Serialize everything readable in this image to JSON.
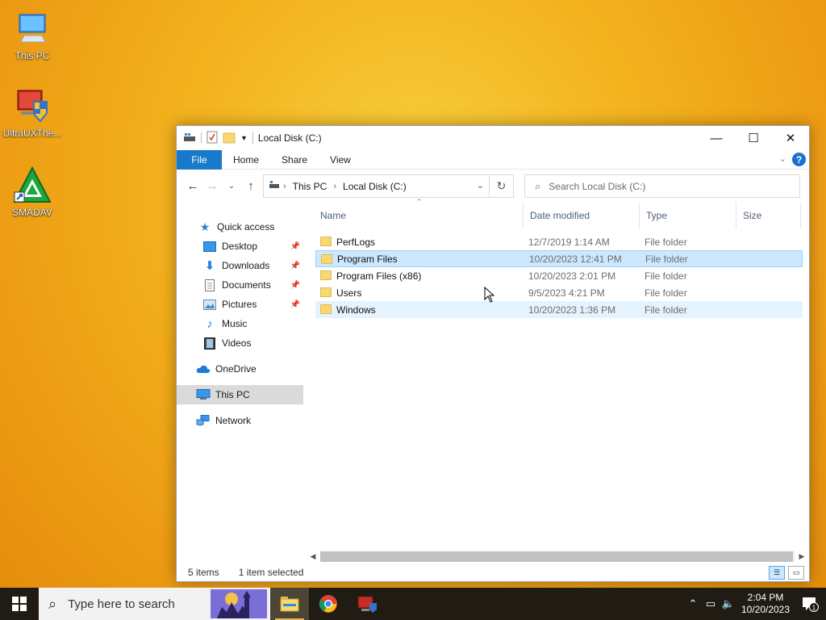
{
  "desktop": {
    "icons": [
      {
        "label": "This PC"
      },
      {
        "label": "UltraUXThe..."
      },
      {
        "label": "SMADAV"
      }
    ]
  },
  "window": {
    "title": "Local Disk (C:)",
    "ribbon_tabs": [
      "File",
      "Home",
      "Share",
      "View"
    ],
    "address": {
      "crumbs": [
        "This PC",
        "Local Disk (C:)"
      ]
    },
    "search_placeholder": "Search Local Disk (C:)",
    "nav": {
      "quick_access": "Quick access",
      "items": [
        "Desktop",
        "Downloads",
        "Documents",
        "Pictures",
        "Music",
        "Videos"
      ],
      "onedrive": "OneDrive",
      "this_pc": "This PC",
      "network": "Network"
    },
    "columns": [
      "Name",
      "Date modified",
      "Type",
      "Size"
    ],
    "files": [
      {
        "name": "PerfLogs",
        "date": "12/7/2019 1:14 AM",
        "type": "File folder"
      },
      {
        "name": "Program Files",
        "date": "10/20/2023 12:41 PM",
        "type": "File folder"
      },
      {
        "name": "Program Files (x86)",
        "date": "10/20/2023 2:01 PM",
        "type": "File folder"
      },
      {
        "name": "Users",
        "date": "9/5/2023 4:21 PM",
        "type": "File folder"
      },
      {
        "name": "Windows",
        "date": "10/20/2023 1:36 PM",
        "type": "File folder"
      }
    ],
    "status": {
      "count": "5 items",
      "selection": "1 item selected"
    }
  },
  "taskbar": {
    "search_placeholder": "Type here to search",
    "time": "2:04 PM",
    "date": "10/20/2023",
    "notification_count": "1"
  },
  "colors": {
    "accent": "#1979ca",
    "selection": "#cce8ff",
    "hover": "#e5f3ff",
    "folder": "#f8d775"
  }
}
